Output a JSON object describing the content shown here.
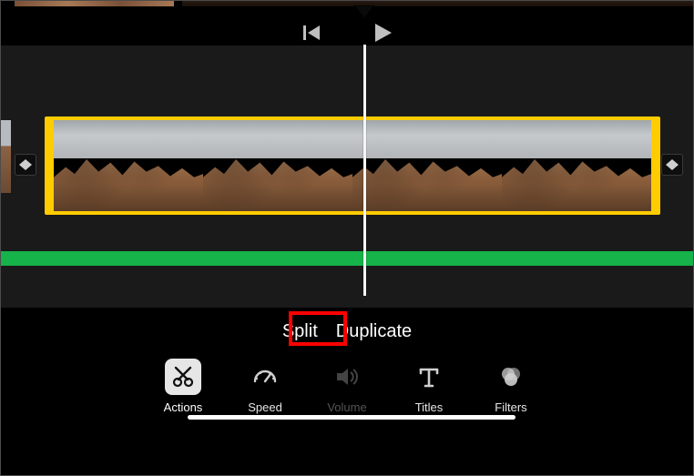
{
  "playback": {
    "prev_label": "previous-frame",
    "play_label": "play"
  },
  "context_actions": {
    "split": "Split",
    "duplicate": "Duplicate"
  },
  "toolbar": {
    "actions": {
      "label": "Actions"
    },
    "speed": {
      "label": "Speed"
    },
    "volume": {
      "label": "Volume"
    },
    "titles": {
      "label": "Titles"
    },
    "filters": {
      "label": "Filters"
    }
  },
  "colors": {
    "selection": "#ffcc00",
    "audio": "#16b24a",
    "highlight": "#ff0000"
  }
}
